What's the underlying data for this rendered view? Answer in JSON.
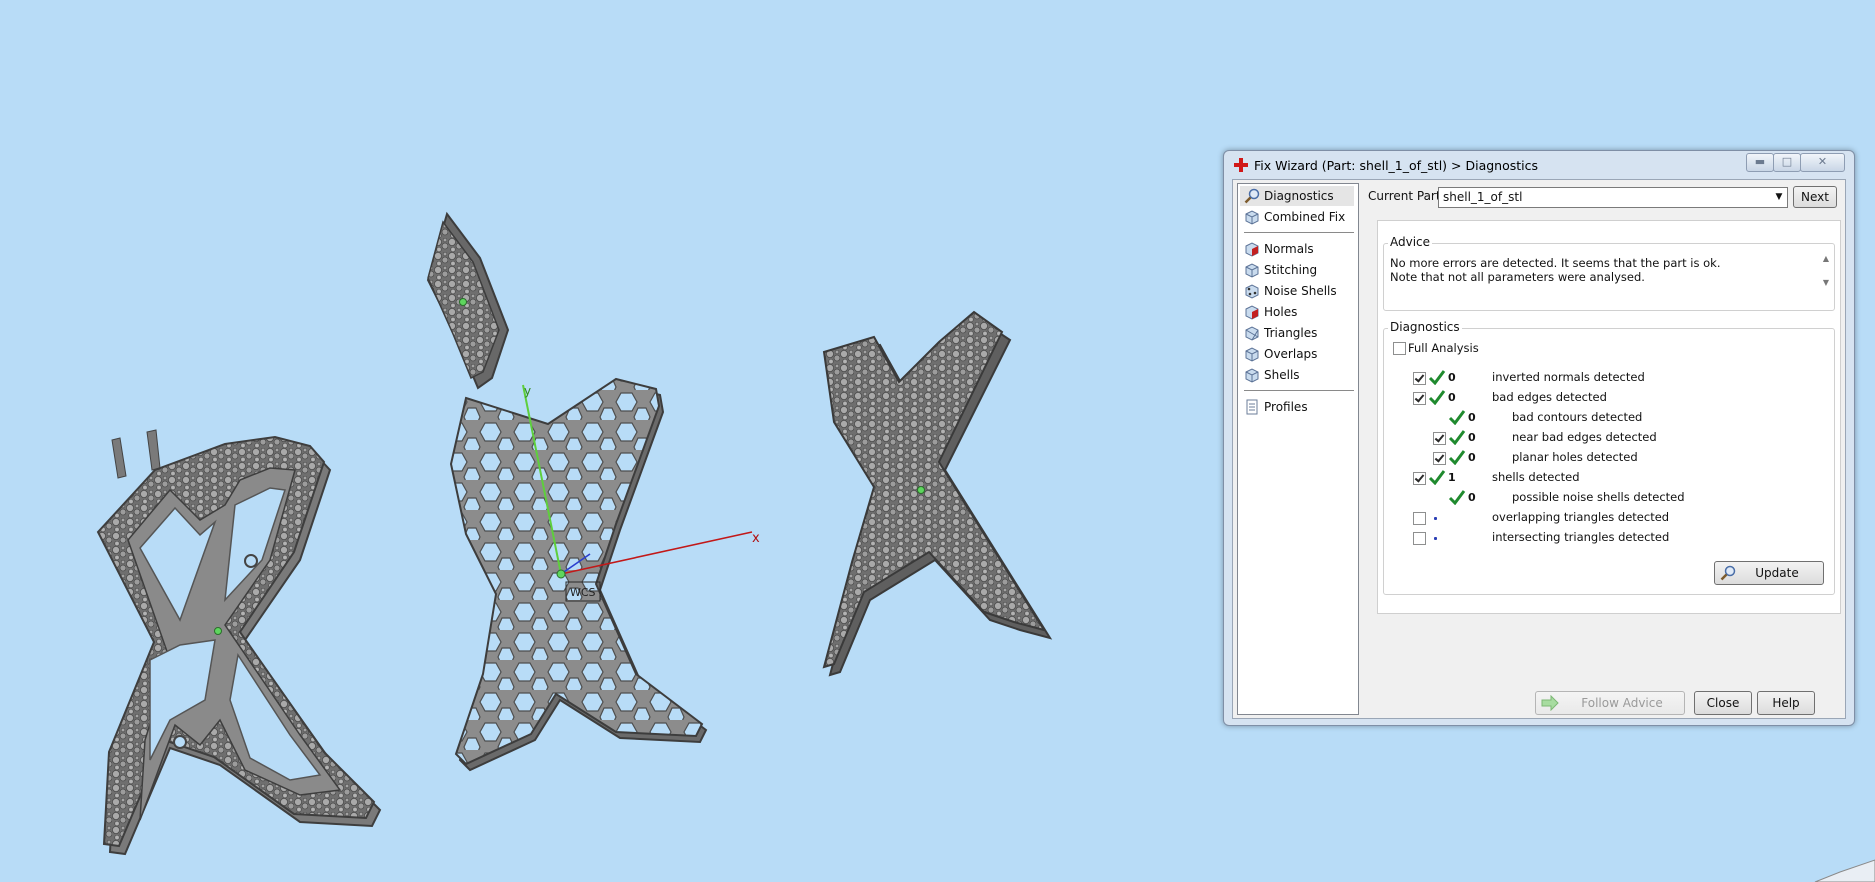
{
  "dialog": {
    "title": "Fix Wizard (Part: shell_1_of_stl) > Diagnostics",
    "nav": {
      "items": [
        {
          "label": "Diagnostics",
          "icon": "magnifier-icon"
        },
        {
          "label": "Combined Fix",
          "icon": "cube-icon"
        },
        {
          "label": "Normals",
          "icon": "normals-icon"
        },
        {
          "label": "Stitching",
          "icon": "stitching-icon"
        },
        {
          "label": "Noise Shells",
          "icon": "noise-shells-icon"
        },
        {
          "label": "Holes",
          "icon": "holes-icon"
        },
        {
          "label": "Triangles",
          "icon": "triangles-icon"
        },
        {
          "label": "Overlaps",
          "icon": "overlaps-icon"
        },
        {
          "label": "Shells",
          "icon": "shells-icon"
        },
        {
          "label": "Profiles",
          "icon": "profiles-icon"
        }
      ]
    },
    "current_part": {
      "label": "Current Part:",
      "value": "shell_1_of_stl"
    },
    "next_label": "Next",
    "advice": {
      "title": "Advice",
      "text": "No more errors are detected. It seems that the part is ok. Note that not all parameters were analysed."
    },
    "diagnostics": {
      "title": "Diagnostics",
      "full_analysis_label": "Full Analysis",
      "rows": [
        {
          "count": "0",
          "text": "inverted normals detected"
        },
        {
          "count": "0",
          "text": "bad edges detected"
        },
        {
          "count": "0",
          "text": "bad contours detected"
        },
        {
          "count": "0",
          "text": "near bad edges detected"
        },
        {
          "count": "0",
          "text": "planar holes detected"
        },
        {
          "count": "1",
          "text": "shells detected"
        },
        {
          "count": "0",
          "text": "possible noise shells detected"
        },
        {
          "count": "",
          "text": "overlapping triangles detected"
        },
        {
          "count": "",
          "text": "intersecting triangles detected"
        }
      ],
      "update_label": "Update"
    },
    "footer": {
      "follow_advice_label": "Follow Advice",
      "close_label": "Close",
      "help_label": "Help"
    }
  },
  "viewport": {
    "axis_x_label": "x",
    "axis_y_label": "y",
    "wcs_label": "WCS"
  }
}
